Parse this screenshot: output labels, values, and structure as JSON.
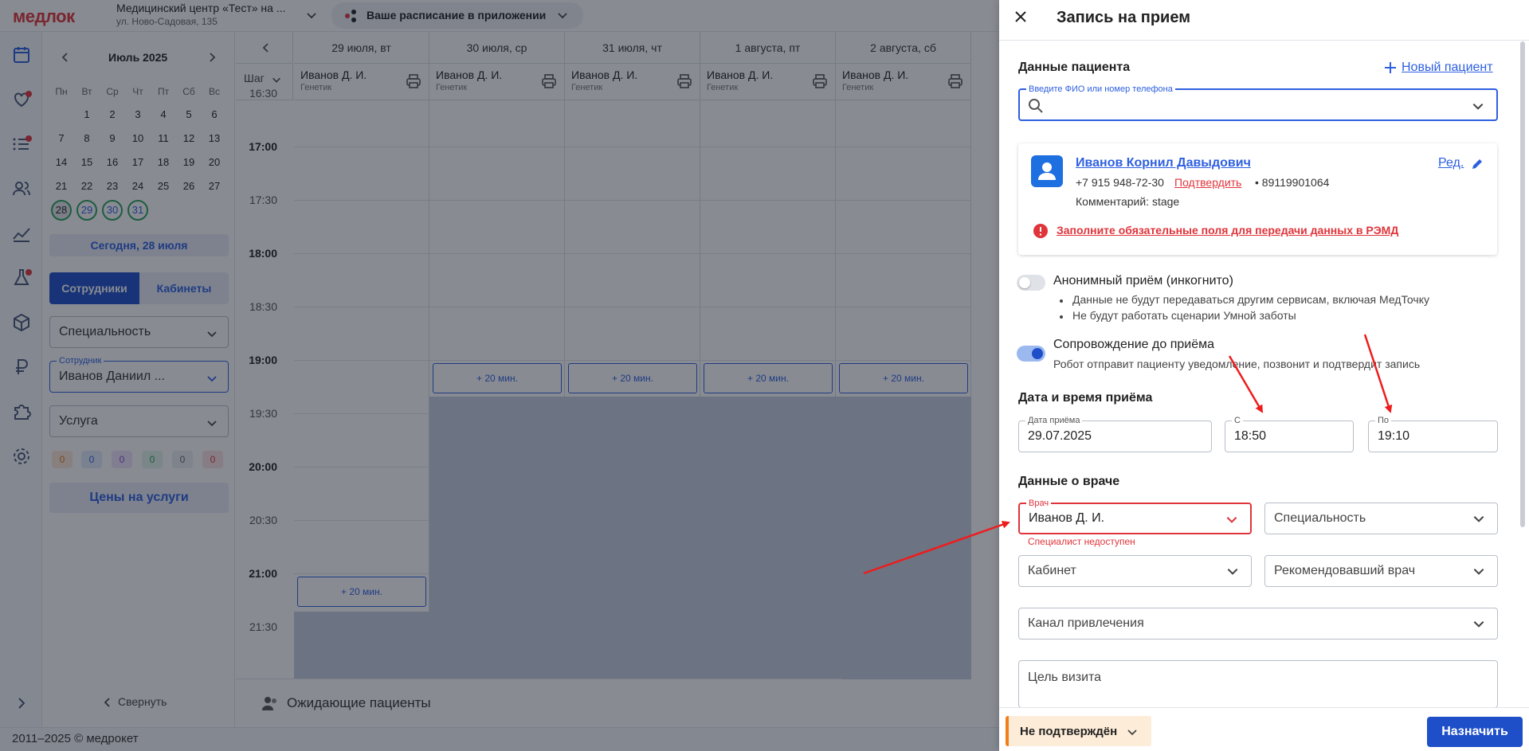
{
  "header": {
    "logo": "медлок",
    "clinic_name": "Медицинский центр «Тест» на ...",
    "clinic_address": "ул. Ново-Садовая, 135",
    "app_promo": "Ваше расписание в приложении"
  },
  "calendar": {
    "month": "Июль 2025",
    "weekdays": [
      "Пн",
      "Вт",
      "Ср",
      "Чт",
      "Пт",
      "Сб",
      "Вс"
    ],
    "rows": [
      [
        "",
        "1",
        "2",
        "3",
        "4",
        "5",
        "6"
      ],
      [
        "7",
        "8",
        "9",
        "10",
        "11",
        "12",
        "13"
      ],
      [
        "14",
        "15",
        "16",
        "17",
        "18",
        "19",
        "20"
      ],
      [
        "21",
        "22",
        "23",
        "24",
        "25",
        "26",
        "27"
      ],
      [
        "28",
        "29",
        "30",
        "31",
        "",
        "",
        ""
      ]
    ],
    "today_button": "Сегодня, 28 июля"
  },
  "sidebar": {
    "tab_staff": "Сотрудники",
    "tab_rooms": "Кабинеты",
    "specialty": "Специальность",
    "employee_label": "Сотрудник",
    "employee_value": "Иванов Даниил ...",
    "service": "Услуга",
    "badges": [
      "0",
      "0",
      "0",
      "0",
      "0",
      "0"
    ],
    "prices_button": "Цены на услуги",
    "collapse": "Свернуть"
  },
  "schedule": {
    "step_label": "Шаг",
    "days": [
      "29 июля, вт",
      "30 июля, ср",
      "31 июля, чт",
      "1 августа, пт",
      "2 августа, сб"
    ],
    "staff_name": "Иванов Д. И.",
    "staff_spec": "Генетик",
    "times": [
      "16:30",
      "17:00",
      "17:30",
      "18:00",
      "18:30",
      "19:00",
      "19:30",
      "20:00",
      "20:30",
      "21:00",
      "21:30"
    ],
    "slot_label": "+ 20 мин.",
    "waiting": "Ожидающие пациенты"
  },
  "footer": {
    "copyright": "2011–2025 © медрокет"
  },
  "drawer": {
    "title": "Запись на прием",
    "patient_section": "Данные пациента",
    "new_patient": "Новый пациент",
    "search_label": "Введите ФИО или номер телефона",
    "patient": {
      "name": "Иванов Корнил Давыдович",
      "phone": "+7 915 948-72-30",
      "confirm": "Подтвердить",
      "phone2": "• 89119901064",
      "comment": "Комментарий: stage",
      "edit": "Ред.",
      "warning": "Заполните обязательные поля для передачи данных в РЭМД"
    },
    "anonymous": {
      "title": "Анонимный приём (инкогнито)",
      "bullets": [
        "Данные не будут передаваться другим сервисам, включая МедТочку",
        "Не будут работать сценарии Умной заботы"
      ]
    },
    "escort": {
      "title": "Сопровождение до приёма",
      "desc": "Робот отправит пациенту уведомление, позвонит и подтвердит запись"
    },
    "datetime_section": "Дата и время приёма",
    "date_label": "Дата приёма",
    "date_value": "29.07.2025",
    "from_label": "С",
    "from_value": "18:50",
    "to_label": "По",
    "to_value": "19:10",
    "doctor_section": "Данные о враче",
    "doctor_label": "Врач",
    "doctor_value": "Иванов Д. И.",
    "doctor_error": "Специалист недоступен",
    "specialty": "Специальность",
    "room": "Кабинет",
    "referrer": "Рекомендовавший врач",
    "channel": "Канал привлечения",
    "purpose": "Цель визита",
    "status": "Не подтверждён",
    "submit": "Назначить"
  },
  "colors": {
    "accent": "#1e4fc9",
    "error": "#e0343a",
    "success": "#2aa35a",
    "warning": "#f07e1a",
    "annotation_arrows": "#ee1c1c"
  }
}
